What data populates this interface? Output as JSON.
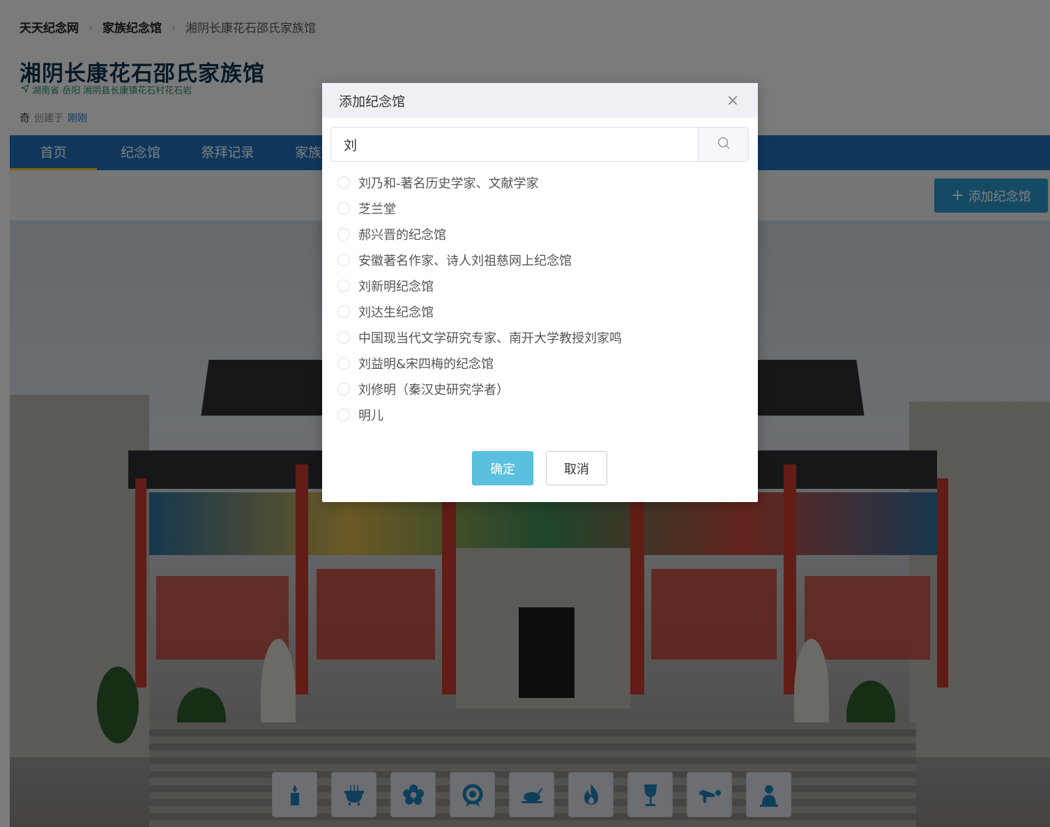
{
  "breadcrumb": {
    "home": "天天纪念网",
    "category": "家族纪念馆",
    "current": "湘阴长康花石邵氏家族馆"
  },
  "hall": {
    "title": "湘阴长康花石邵氏家族馆",
    "location": "湖南省 岳阳 湘阴县长康镇花石村花石岩",
    "creator_name": "奇",
    "created_label": "创建于",
    "created_when": "刚刚"
  },
  "nav": {
    "items": [
      "首页",
      "纪念馆",
      "祭拜记录",
      "家族介"
    ]
  },
  "toolbar": {
    "add_hall_label": "添加纪念馆"
  },
  "offerings": {
    "icons": [
      "candle-icon",
      "incense-burner-icon",
      "flower-icon",
      "wreath-icon",
      "roast-chicken-icon",
      "fire-icon",
      "wine-glass-icon",
      "kneel-icon",
      "statue-icon"
    ]
  },
  "modal": {
    "title": "添加纪念馆",
    "search": {
      "value": "刘"
    },
    "results": [
      "刘乃和-著名历史学家、文献学家",
      "芝兰堂",
      "郝兴晋的纪念馆",
      "安徽著名作家、诗人刘祖慈网上纪念馆",
      "刘新明纪念馆",
      "刘达生纪念馆",
      "中国现当代文学研究专家、南开大学教授刘家鸣",
      "刘益明&宋四梅的纪念馆",
      "刘修明（秦汉史研究学者）",
      "明儿"
    ],
    "confirm_label": "确定",
    "cancel_label": "取消"
  },
  "colors": {
    "nav_bg": "#1e6fb8",
    "accent": "#2a94c9",
    "confirm_bg": "#5bc0de",
    "title_color": "#0d3350"
  }
}
